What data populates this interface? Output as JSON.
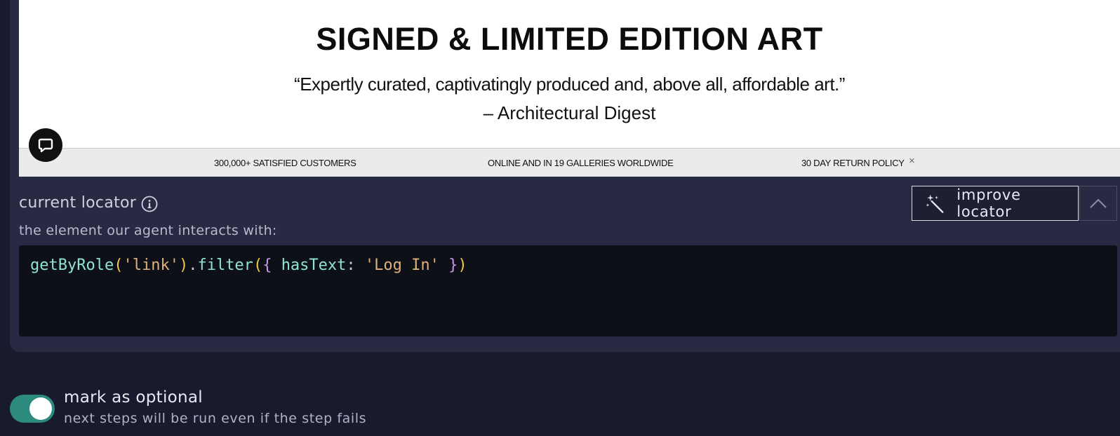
{
  "preview": {
    "headline": "SIGNED & LIMITED EDITION ART",
    "quote": "“Expertly curated, captivatingly produced and, above all, affordable art.”",
    "attribution": "– Architectural Digest",
    "benefits": [
      "300,000+ SATISFIED CUSTOMERS",
      "ONLINE AND IN 19 GALLERIES WORLDWIDE",
      "30 DAY RETURN POLICY"
    ],
    "close_glyph": "×"
  },
  "locator": {
    "title": "current locator",
    "subtitle": "the element our agent interacts with:",
    "improve_label": "improve locator",
    "code": {
      "method": "getByRole",
      "role_arg": "'link'",
      "filter": "filter",
      "key": "hasText",
      "value": "'Log In'"
    }
  },
  "optional": {
    "title": "mark as optional",
    "description": "next steps will be run even if the step fails",
    "enabled": true
  },
  "colors": {
    "accent_toggle": "#2d8a7e",
    "panel_bg": "#272a42",
    "page_bg": "#181a2e",
    "code_bg": "#0e1018"
  }
}
